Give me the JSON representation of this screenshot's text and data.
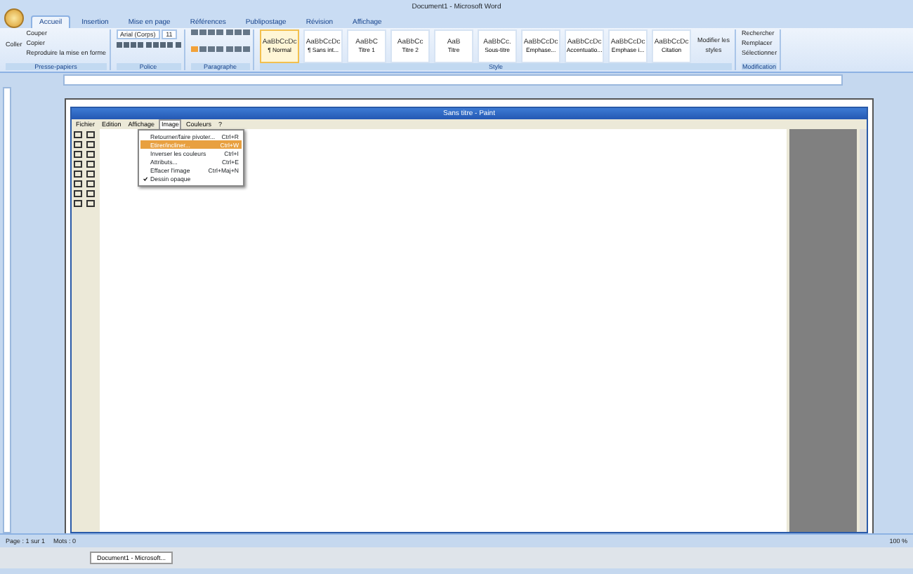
{
  "window": {
    "title": "Document1 - Microsoft Word"
  },
  "tabs": [
    {
      "label": "Accueil",
      "selected": true
    },
    {
      "label": "Insertion",
      "selected": false
    },
    {
      "label": "Mise en page",
      "selected": false
    },
    {
      "label": "Références",
      "selected": false
    },
    {
      "label": "Publipostage",
      "selected": false
    },
    {
      "label": "Révision",
      "selected": false
    },
    {
      "label": "Affichage",
      "selected": false
    }
  ],
  "clipboard": {
    "paste": "Coller",
    "items": [
      "Couper",
      "Copier",
      "Reproduire la mise en forme"
    ],
    "group": "Presse-papiers"
  },
  "font": {
    "name": "Arial (Corps)",
    "size": "11",
    "group": "Police"
  },
  "paragraph": {
    "group": "Paragraphe"
  },
  "styles": {
    "items": [
      {
        "preview": "AaBbCcDc",
        "label": "¶ Normal",
        "selected": true
      },
      {
        "preview": "AaBbCcDc",
        "label": "¶ Sans int...",
        "selected": false
      },
      {
        "preview": "AaBbC",
        "label": "Titre 1",
        "selected": false
      },
      {
        "preview": "AaBbCc",
        "label": "Titre 2",
        "selected": false
      },
      {
        "preview": "AaB",
        "label": "Titre",
        "selected": false
      },
      {
        "preview": "AaBbCc.",
        "label": "Sous-titre",
        "selected": false
      },
      {
        "preview": "AaBbCcDc",
        "label": "Emphase...",
        "selected": false
      },
      {
        "preview": "AaBbCcDc",
        "label": "Accentuatio...",
        "selected": false
      },
      {
        "preview": "AaBbCcDc",
        "label": "Emphase i...",
        "selected": false
      },
      {
        "preview": "AaBbCcDc",
        "label": "Citation",
        "selected": false
      }
    ],
    "change": "Modifier les styles",
    "group": "Style"
  },
  "editing": {
    "items": [
      "Rechercher",
      "Remplacer",
      "Sélectionner"
    ],
    "group": "Modification"
  },
  "paint": {
    "title": "Sans titre - Paint",
    "menu": [
      {
        "label": "Fichier",
        "selected": false
      },
      {
        "label": "Edition",
        "selected": false
      },
      {
        "label": "Affichage",
        "selected": false
      },
      {
        "label": "Image",
        "selected": true
      },
      {
        "label": "Couleurs",
        "selected": false
      },
      {
        "label": "?",
        "selected": false
      }
    ],
    "image_menu": [
      {
        "label": "Retourner/faire pivoter...",
        "shortcut": "Ctrl+R",
        "selected": false,
        "checked": false
      },
      {
        "label": "Etirer/incliner...",
        "shortcut": "Ctrl+W",
        "selected": true,
        "checked": false
      },
      {
        "label": "Inverser les couleurs",
        "shortcut": "Ctrl+I",
        "selected": false,
        "checked": false
      },
      {
        "label": "Attributs...",
        "shortcut": "Ctrl+E",
        "selected": false,
        "checked": false
      },
      {
        "label": "Effacer l'image",
        "shortcut": "Ctrl+Maj+N",
        "selected": false,
        "checked": false
      },
      {
        "label": "Dessin opaque",
        "selected": false,
        "checked": true
      }
    ]
  },
  "status_bar": {
    "page": "Page : 1 sur 1",
    "words": "Mots : 0",
    "zoom": "100 %"
  },
  "taskbar": {
    "item": "Document1 - Microsoft..."
  }
}
